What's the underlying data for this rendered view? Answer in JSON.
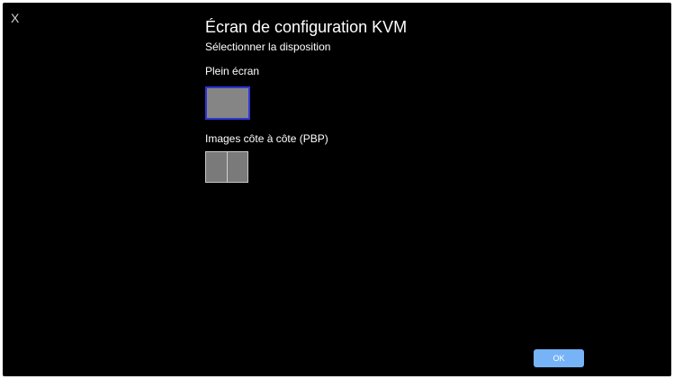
{
  "window": {
    "close_label": "X",
    "title": "Écran de configuration KVM"
  },
  "layout_section": {
    "heading": "Sélectionner la disposition",
    "options": [
      {
        "label": "Plein écran",
        "selected": true,
        "icon": "full-screen-layout-icon"
      },
      {
        "label": "Images côte à côte (PBP)",
        "selected": false,
        "icon": "side-by-side-layout-icon"
      }
    ]
  },
  "footer": {
    "ok_label": "OK"
  },
  "colors": {
    "background": "#000000",
    "selection_border": "#2f34d6",
    "ok_button": "#77b3f7",
    "tile": "#7a7a7a"
  }
}
